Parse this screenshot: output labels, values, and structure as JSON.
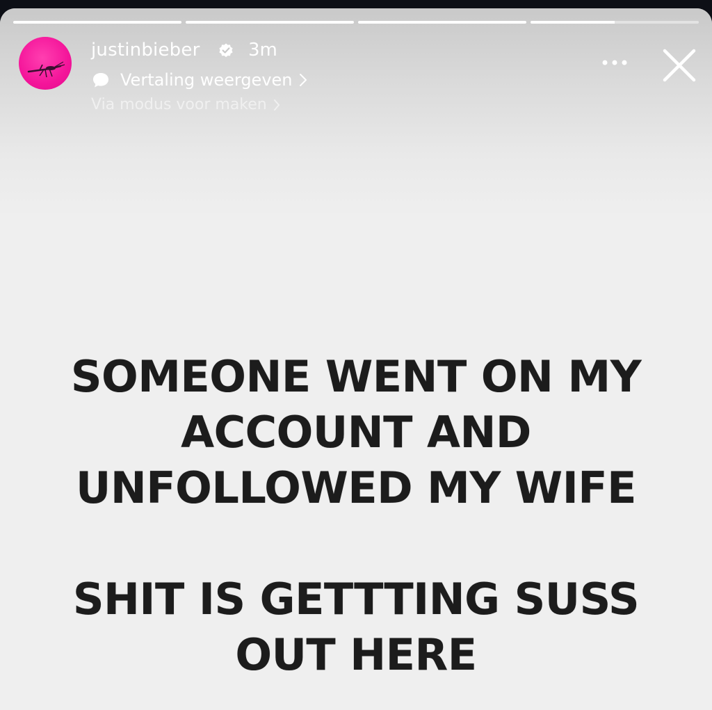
{
  "story": {
    "progress_fractions": [
      1,
      1,
      1,
      0.5
    ],
    "header": {
      "username": "justinbieber",
      "time_ago": "3m",
      "translate_label": "Vertaling weergeven",
      "create_mode_label": "Via modus voor maken"
    },
    "message": {
      "paragraph_1": "SOMEONE WENT ON MY ACCOUNT AND UNFOLLOWED MY WIFE",
      "paragraph_2": "SHIT IS GETTTING SUSS OUT HERE"
    }
  },
  "icons": {
    "verified": "verified-badge-icon",
    "translate": "speech-bubble-icon",
    "chevron": "chevron-right-icon",
    "more": "more-options-icon",
    "close": "close-icon"
  },
  "colors": {
    "avatar_pink": "#f4159a",
    "story_background": "#efefef",
    "text_dark": "#1c1c1c",
    "ui_white": "#ffffff"
  }
}
